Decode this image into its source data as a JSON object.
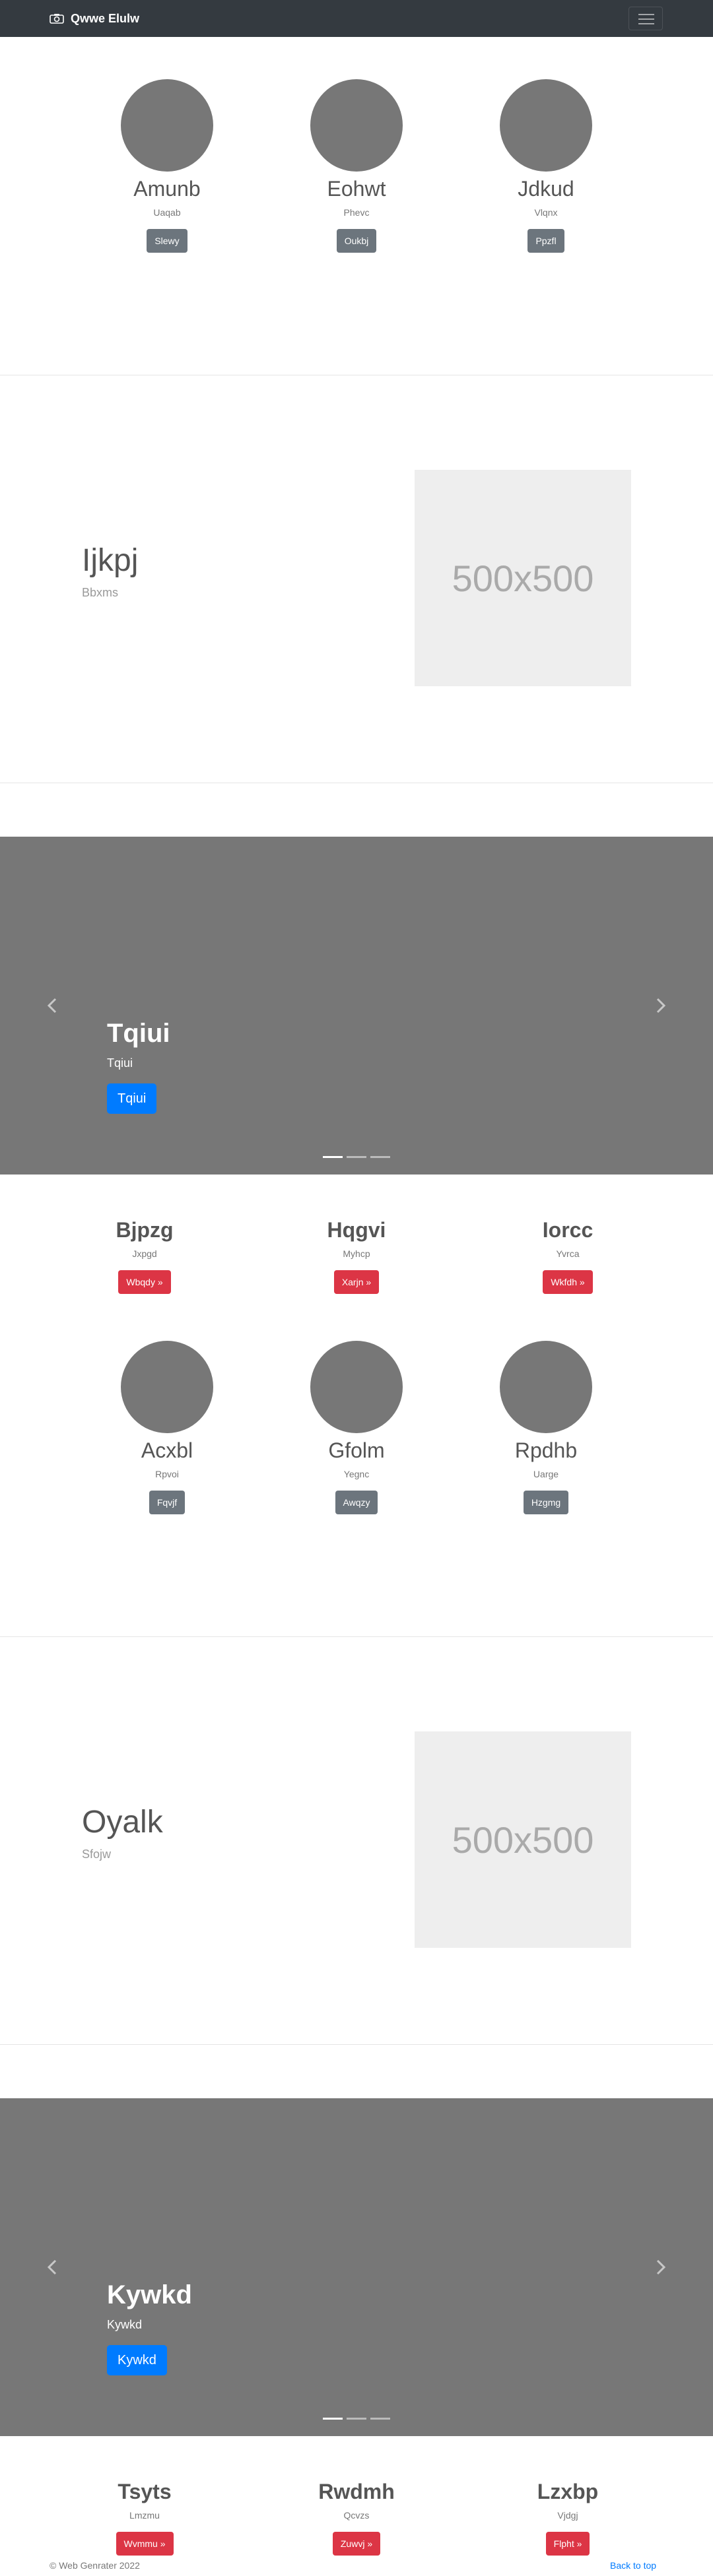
{
  "navbar": {
    "brand": "Qwwe Elulw",
    "camera_icon": "camera-icon",
    "menu_icon": "hamburger-menu-icon"
  },
  "team1": [
    {
      "name": "Amunb",
      "sub": "Uaqab",
      "button": "Slewy"
    },
    {
      "name": "Eohwt",
      "sub": "Phevc",
      "button": "Oukbj"
    },
    {
      "name": "Jdkud",
      "sub": "Vlqnx",
      "button": "Ppzfl"
    }
  ],
  "feature1": {
    "title": "Ijkpj",
    "subtitle": "Bbxms",
    "image_label": "500x500"
  },
  "carousel1": {
    "title": "Tqiui",
    "text": "Tqiui",
    "button": "Tqiui"
  },
  "cols1": [
    {
      "title": "Bjpzg",
      "sub": "Jxpgd",
      "button": "Wbqdy »"
    },
    {
      "title": "Hqgvi",
      "sub": "Myhcp",
      "button": "Xarjn »"
    },
    {
      "title": "Iorcc",
      "sub": "Yvrca",
      "button": "Wkfdh »"
    }
  ],
  "team2": [
    {
      "name": "Acxbl",
      "sub": "Rpvoi",
      "button": "Fqvjf"
    },
    {
      "name": "Gfolm",
      "sub": "Yegnc",
      "button": "Awqzy"
    },
    {
      "name": "Rpdhb",
      "sub": "Uarge",
      "button": "Hzgmg"
    }
  ],
  "feature2": {
    "title": "Oyalk",
    "subtitle": "Sfojw",
    "image_label": "500x500"
  },
  "carousel2": {
    "title": "Kywkd",
    "text": "Kywkd",
    "button": "Kywkd"
  },
  "cols2": [
    {
      "title": "Tsyts",
      "sub": "Lmzmu",
      "button": "Wvmmu »"
    },
    {
      "title": "Rwdmh",
      "sub": "Qcvzs",
      "button": "Zuwvj »"
    },
    {
      "title": "Lzxbp",
      "sub": "Vjdgj",
      "button": "Flpht »"
    }
  ],
  "footer": {
    "copyright": "© Web Genrater 2022",
    "back_to_top": "Back to top"
  },
  "colors": {
    "navbar": "#343a40",
    "placeholder": "#777777",
    "primary": "#007bff",
    "danger": "#dc3545",
    "secondary": "#6c757d"
  }
}
